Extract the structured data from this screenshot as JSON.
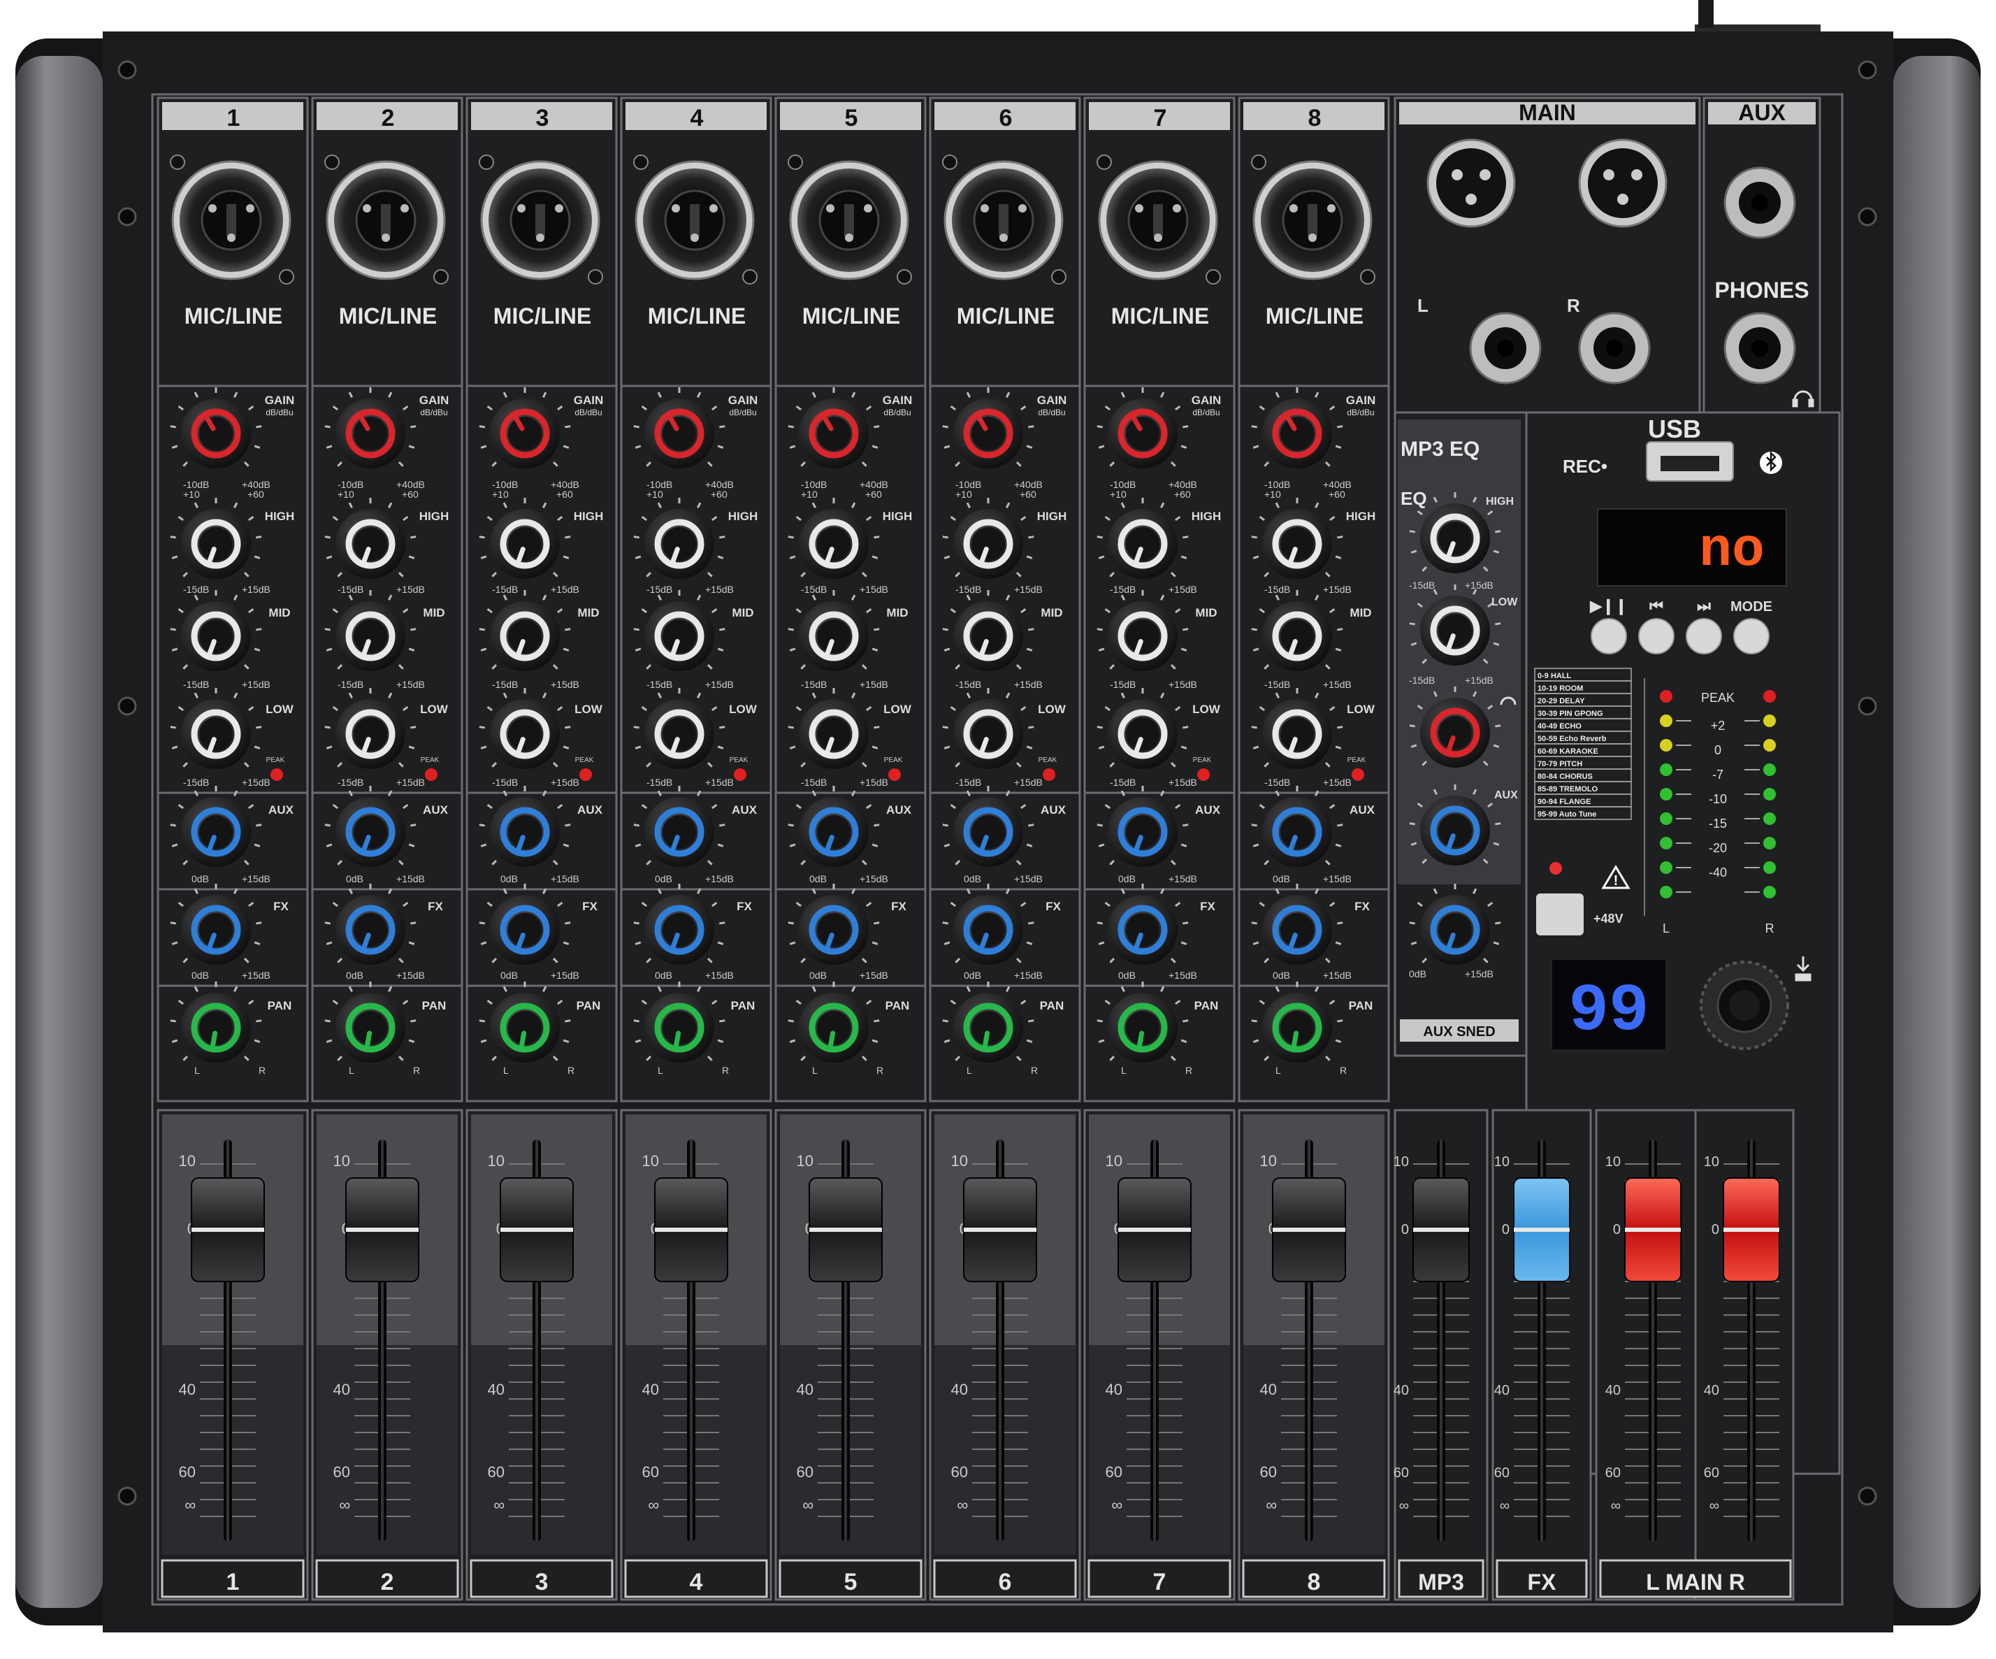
{
  "channels": [
    {
      "number": "1",
      "input_label": "MIC/LINE",
      "fader_label": "1"
    },
    {
      "number": "2",
      "input_label": "MIC/LINE",
      "fader_label": "2"
    },
    {
      "number": "3",
      "input_label": "MIC/LINE",
      "fader_label": "3"
    },
    {
      "number": "4",
      "input_label": "MIC/LINE",
      "fader_label": "4"
    },
    {
      "number": "5",
      "input_label": "MIC/LINE",
      "fader_label": "5"
    },
    {
      "number": "6",
      "input_label": "MIC/LINE",
      "fader_label": "6"
    },
    {
      "number": "7",
      "input_label": "MIC/LINE",
      "fader_label": "7"
    },
    {
      "number": "8",
      "input_label": "MIC/LINE",
      "fader_label": "8"
    }
  ],
  "knob_labels": {
    "gain": "GAIN",
    "gain_unit": "dB/dBu",
    "gain_min": "-10dB",
    "gain_min2": "+10",
    "gain_max": "+40dB",
    "gain_max2": "+60",
    "high": "HIGH",
    "mid": "MID",
    "low": "LOW",
    "eq_min": "-15dB",
    "eq_max": "+15dB",
    "peak": "PEAK",
    "aux": "AUX",
    "fx": "FX",
    "send_min": "0dB",
    "send_max": "+15dB",
    "pan": "PAN",
    "pan_l": "L",
    "pan_r": "R"
  },
  "knob_colors": {
    "gain": "#d8262c",
    "eq": "#e8e8e8",
    "aux": "#2f7fd8",
    "fx": "#2f7fd8",
    "pan": "#28b84a"
  },
  "outputs": {
    "main_title": "MAIN",
    "aux_title": "AUX",
    "phones_title": "PHONES",
    "main_l": "L",
    "main_r": "R"
  },
  "mp3_section": {
    "title": "MP3 EQ",
    "eq_label": "EQ",
    "high": "HIGH",
    "low": "LOW",
    "aux": "AUX",
    "aux_send": "AUX SNED",
    "min": "-15dB",
    "max": "+15dB",
    "send_min": "0dB",
    "send_max": "+15dB"
  },
  "usb_player": {
    "usb_label": "USB",
    "rec_label": "REC•",
    "display": "no",
    "buttons": [
      "▶❙❙",
      "⏮",
      "⏭",
      "MODE"
    ],
    "bluetooth_icon": "bluetooth-icon"
  },
  "effects_list": [
    "0-9 HALL",
    "10-19 ROOM",
    "20-29 DELAY",
    "30-39 PIN GPONG",
    "40-49 ECHO",
    "50-59 Echo Reverb",
    "60-69 KARAOKE",
    "70-79 PITCH",
    "80-84 CHORUS",
    "85-89 TREMOLO",
    "90-94 FLANGE",
    "95-99 Auto Tune"
  ],
  "phantom": {
    "label": "+48V",
    "warning_icon": "warning-icon"
  },
  "meter": {
    "peak": "PEAK",
    "marks": [
      "+2",
      "0",
      "-7",
      "-10",
      "-15",
      "-20",
      "-40"
    ],
    "left": "L",
    "right": "R"
  },
  "fx_display": {
    "value": "99"
  },
  "fader_scale": [
    "10",
    "0",
    "40",
    "60",
    "∞"
  ],
  "faders": [
    {
      "label": "1",
      "level": 0.88,
      "cap": "black"
    },
    {
      "label": "2",
      "level": 0.88,
      "cap": "black"
    },
    {
      "label": "3",
      "level": 0.88,
      "cap": "black"
    },
    {
      "label": "4",
      "level": 0.88,
      "cap": "black"
    },
    {
      "label": "5",
      "level": 0.88,
      "cap": "black"
    },
    {
      "label": "6",
      "level": 0.88,
      "cap": "black"
    },
    {
      "label": "7",
      "level": 0.88,
      "cap": "black"
    },
    {
      "label": "8",
      "level": 0.88,
      "cap": "black"
    },
    {
      "label": "MP3",
      "level": 0.88,
      "cap": "black"
    },
    {
      "label": "FX",
      "level": 0.88,
      "cap": "blue"
    },
    {
      "label": "L",
      "level": 0.88,
      "cap": "red"
    },
    {
      "label": "R",
      "level": 0.88,
      "cap": "red"
    }
  ],
  "bottom_labels": {
    "mp3": "MP3",
    "fx": "FX",
    "main": "L MAIN R"
  },
  "colors": {
    "panel": "#1b1c1e",
    "strip": "#2a2b2e",
    "label_bg": "#c8c8c8",
    "seg_red": "#ff5a1e",
    "seg_blue": "#3a6bff",
    "fader_blue": "#4aa8e8",
    "fader_red": "#e02020"
  }
}
